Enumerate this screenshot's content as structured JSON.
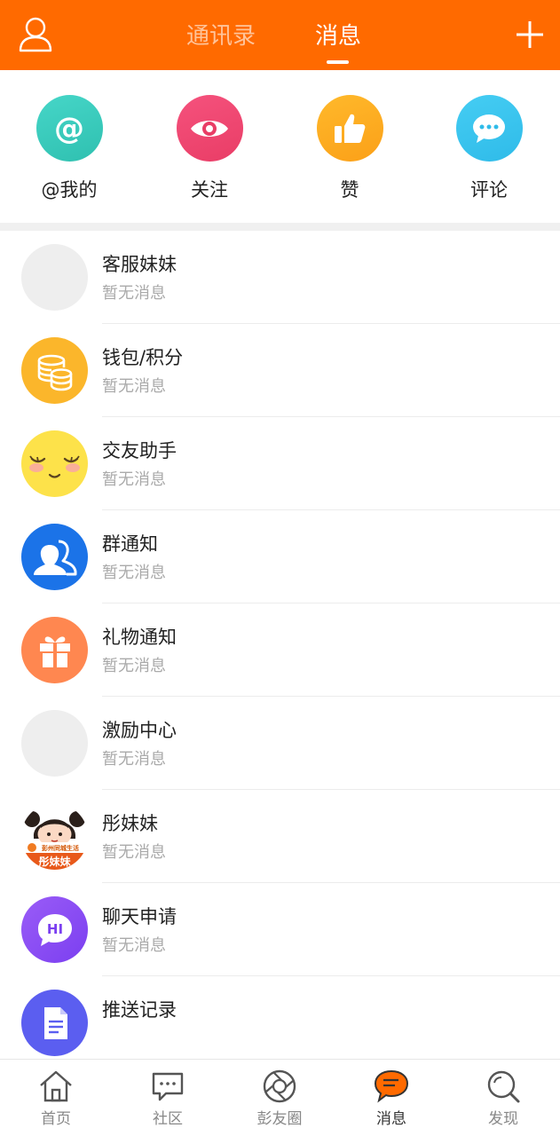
{
  "header": {
    "tabs": [
      {
        "label": "通讯录",
        "active": false
      },
      {
        "label": "消息",
        "active": true
      }
    ],
    "icons": {
      "left": "user-icon",
      "right": "plus-icon"
    },
    "colors": {
      "background": "#ff6a00"
    }
  },
  "quick_actions": [
    {
      "label": "@我的",
      "icon": "at-icon",
      "color": "#3fd0c0"
    },
    {
      "label": "关注",
      "icon": "eye-icon",
      "color": "#f04a74"
    },
    {
      "label": "赞",
      "icon": "thumbs-up-icon",
      "color": "#ffae1f"
    },
    {
      "label": "评论",
      "icon": "comment-icon",
      "color": "#38c4ee"
    }
  ],
  "messages": [
    {
      "title": "客服妹妹",
      "subtitle": "暂无消息",
      "icon": "placeholder-avatar"
    },
    {
      "title": "钱包/积分",
      "subtitle": "暂无消息",
      "icon": "coins-icon"
    },
    {
      "title": "交友助手",
      "subtitle": "暂无消息",
      "icon": "smiley-face-icon"
    },
    {
      "title": "群通知",
      "subtitle": "暂无消息",
      "icon": "group-icon"
    },
    {
      "title": "礼物通知",
      "subtitle": "暂无消息",
      "icon": "gift-icon"
    },
    {
      "title": "激励中心",
      "subtitle": "暂无消息",
      "icon": "placeholder-avatar"
    },
    {
      "title": "彤妹妹",
      "subtitle": "暂无消息",
      "icon": "character-avatar"
    },
    {
      "title": "聊天申请",
      "subtitle": "暂无消息",
      "icon": "hi-chat-icon"
    },
    {
      "title": "推送记录",
      "subtitle": "",
      "icon": "document-icon"
    }
  ],
  "avatar_texts": {
    "hi": "HI",
    "brand": "彭州同城生活",
    "mascot": "彤妹妹"
  },
  "bottom_nav": [
    {
      "label": "首页",
      "icon": "home-icon",
      "active": false
    },
    {
      "label": "社区",
      "icon": "community-chat-icon",
      "active": false
    },
    {
      "label": "彭友圈",
      "icon": "aperture-icon",
      "active": false
    },
    {
      "label": "消息",
      "icon": "message-icon",
      "active": true
    },
    {
      "label": "发现",
      "icon": "search-icon",
      "active": false
    }
  ],
  "colors": {
    "accent": "#ff6a00",
    "text": "#222222",
    "subtext": "#aaaaaa"
  }
}
